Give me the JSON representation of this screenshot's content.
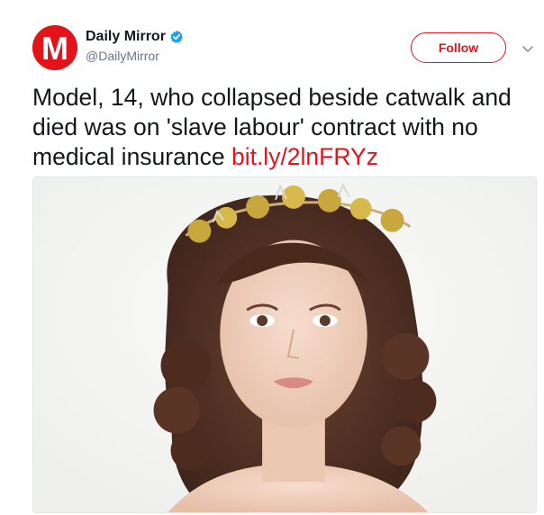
{
  "header": {
    "display_name": "Daily Mirror",
    "handle": "@DailyMirror",
    "avatar_letter": "M",
    "follow_label": "Follow",
    "verified_icon": "verified-badge-icon",
    "menu_icon": "chevron-down-icon"
  },
  "tweet": {
    "text": "Model, 14, who collapsed beside catwalk and died was on 'slave labour' contract with no medical insurance ",
    "link": "bit.ly/2lnFRYz"
  },
  "colors": {
    "brand": "#e2141a",
    "verified": "#1da1f2",
    "text": "#14171a",
    "muted": "#657786"
  }
}
